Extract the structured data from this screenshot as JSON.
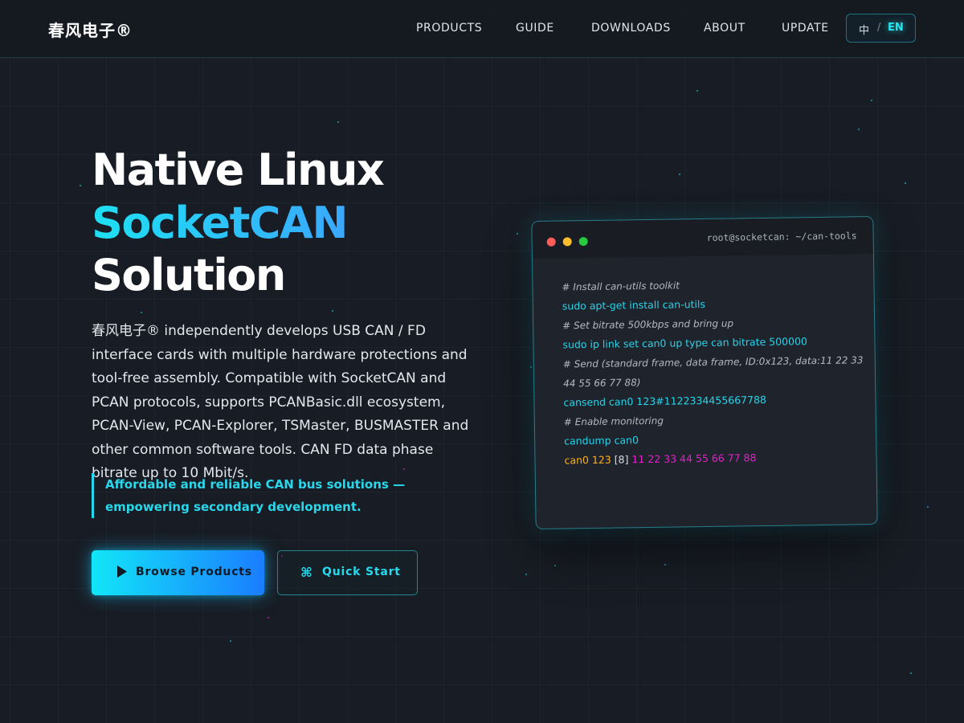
{
  "header": {
    "logo": "春风电子®",
    "nav": [
      {
        "label": "PRODUCTS"
      },
      {
        "label": "GUIDE"
      },
      {
        "label": "DOWNLOADS"
      },
      {
        "label": "ABOUT"
      },
      {
        "label": "UPDATE"
      }
    ],
    "language": {
      "zh": "中",
      "separator": "/",
      "en": "EN",
      "active": "EN"
    }
  },
  "hero": {
    "title_line1": "Native Linux",
    "title_line2": "SocketCAN",
    "title_line3": "Solution",
    "description": "春风电子® independently develops USB CAN / FD interface cards with multiple hardware protections and tool-free assembly. Compatible with SocketCAN and PCAN protocols, supports PCANBasic.dll ecosystem, PCAN-View, PCAN-Explorer, TSMaster, BUSMASTER and other common software tools. CAN FD data phase bitrate up to 10 Mbit/s.",
    "tagline": "Affordable and reliable CAN bus solutions — empowering secondary development.",
    "buttons": {
      "primary": {
        "icon": "play-icon",
        "label": "Browse Products"
      },
      "secondary": {
        "icon": "command-icon",
        "label": "Quick Start"
      }
    }
  },
  "terminal": {
    "title": "root@socketcan: ~/can-tools",
    "lines": [
      {
        "type": "comment",
        "text": "# Install can-utils toolkit"
      },
      {
        "type": "cmd",
        "text": "sudo apt-get install can-utils"
      },
      {
        "type": "comment",
        "text": "# Set bitrate 500kbps and bring up"
      },
      {
        "type": "cmd",
        "text": "sudo ip link set can0 up type can bitrate 500000"
      },
      {
        "type": "comment",
        "text": "# Send (standard frame, data frame, ID:0x123, data:11 22 33"
      },
      {
        "type": "comment",
        "text": "44 55 66 77 88)"
      },
      {
        "type": "cmd",
        "text": "cansend can0 123#1122334455667788"
      },
      {
        "type": "comment",
        "text": "# Enable monitoring"
      },
      {
        "type": "cmd",
        "text": "candump can0"
      }
    ],
    "output": {
      "device": "can0",
      "id": "123",
      "length": "[8]",
      "data": "11 22 33 44 55 66 77 88"
    }
  },
  "colors": {
    "accent_cyan": "#22d8ec",
    "accent_blue": "#1a7dff",
    "background": "#181c24",
    "output_orange": "#ffb020",
    "output_magenta": "#e61ec9"
  }
}
